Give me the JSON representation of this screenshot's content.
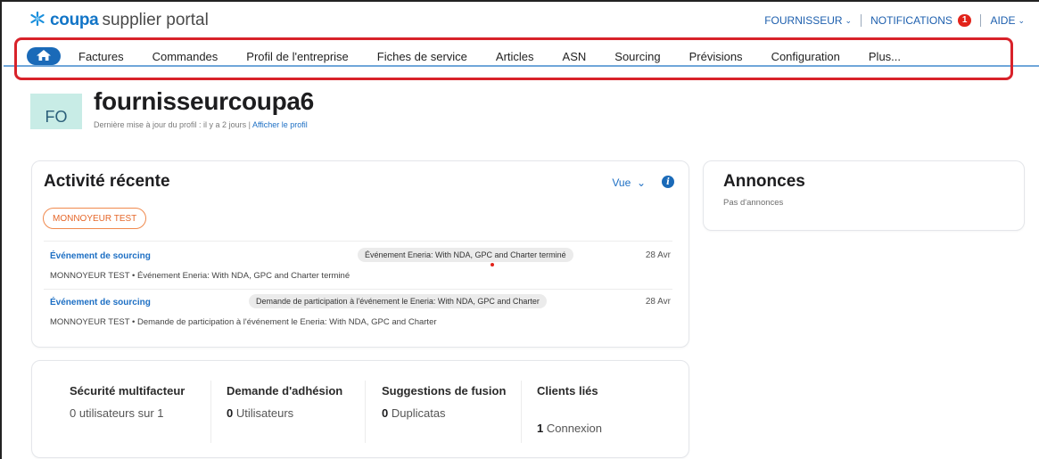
{
  "header": {
    "brand": "coupa",
    "portal": "supplier portal",
    "menu": {
      "fournisseur": "FOURNISSEUR",
      "notifications": "NOTIFICATIONS",
      "notification_count": "1",
      "aide": "AIDE"
    }
  },
  "nav": {
    "items": [
      "Factures",
      "Commandes",
      "Profil de l'entreprise",
      "Fiches de service",
      "Articles",
      "ASN",
      "Sourcing",
      "Prévisions",
      "Configuration",
      "Plus..."
    ]
  },
  "profile": {
    "initials": "FO",
    "name": "fournisseurcoupa6",
    "updated": "Dernière mise à jour du profil : il y a 2 jours |",
    "view_link": "Afficher le profil"
  },
  "activity": {
    "title": "Activité récente",
    "view_label": "Vue",
    "filter_pill": "MONNOYEUR TEST",
    "events": [
      {
        "type": "Événement de sourcing",
        "badge": "Événement Eneria: With NDA, GPC and Charter terminé",
        "date": "28 Avr",
        "description": "MONNOYEUR TEST • Événement Eneria: With NDA, GPC and Charter terminé"
      },
      {
        "type": "Événement de sourcing",
        "badge": "Demande de participation à l'événement le Eneria: With NDA, GPC and Charter",
        "date": "28 Avr",
        "description": "MONNOYEUR TEST • Demande de participation à l'événement le Eneria: With NDA, GPC and Charter"
      }
    ]
  },
  "annonces": {
    "title": "Annonces",
    "empty": "Pas d'annonces"
  },
  "stats": [
    {
      "label": "Sécurité multifacteur",
      "value_num": "",
      "value_text": "0 utilisateurs sur 1"
    },
    {
      "label": "Demande d'adhésion",
      "value_num": "0",
      "value_text": "Utilisateurs"
    },
    {
      "label": "Suggestions de fusion",
      "value_num": "0",
      "value_text": "Duplicatas"
    },
    {
      "label": "Clients liés",
      "value_num": "1",
      "value_text": "Connexion"
    }
  ],
  "colors": {
    "brand_blue": "#1275c7",
    "link_blue": "#1d6fc4",
    "highlight_red": "#d8222a",
    "pill_orange": "#e5672a",
    "avatar_bg": "#c8ece6"
  },
  "icons": [
    "coupa-snowflake-icon",
    "chevron-down-icon",
    "home-icon",
    "info-icon"
  ]
}
